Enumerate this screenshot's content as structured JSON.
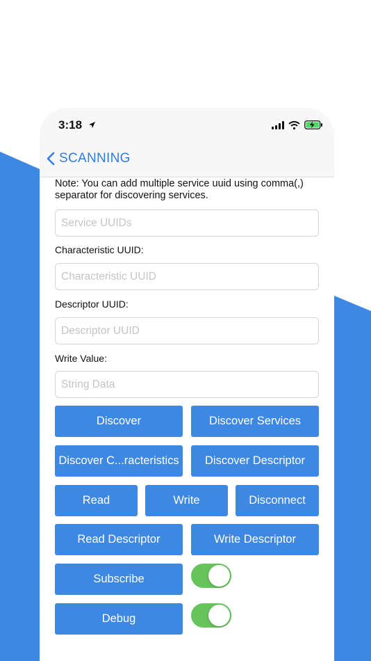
{
  "colors": {
    "brand_blue": "#3d88e3",
    "nav_blue": "#2f7de1",
    "toggle_green": "#66c45a"
  },
  "status_bar": {
    "time": "3:18",
    "icons": [
      "location-arrow-icon",
      "cellular-signal-icon",
      "wifi-icon",
      "battery-charging-icon"
    ]
  },
  "nav": {
    "back_label": "SCANNING"
  },
  "note": "Note: You can add multiple service uuid using comma(,) separator for discovering services.",
  "fields": {
    "service_uuids": {
      "placeholder": "Service UUIDs",
      "value": ""
    },
    "characteristic_label": "Characteristic UUID:",
    "characteristic_uuid": {
      "placeholder": "Characteristic UUID",
      "value": ""
    },
    "descriptor_label": "Descriptor UUID:",
    "descriptor_uuid": {
      "placeholder": "Descriptor UUID",
      "value": ""
    },
    "write_label": "Write Value:",
    "write_value": {
      "placeholder": "String Data",
      "value": ""
    }
  },
  "buttons": {
    "discover": "Discover",
    "discover_services": "Discover Services",
    "discover_characteristics": "Discover C...racteristics",
    "discover_descriptor": "Discover Descriptor",
    "read": "Read",
    "write": "Write",
    "disconnect": "Disconnect",
    "read_descriptor": "Read Descriptor",
    "write_descriptor": "Write Descriptor",
    "subscribe": "Subscribe",
    "debug": "Debug"
  },
  "toggles": {
    "subscribe_on": true,
    "debug_on": true
  }
}
